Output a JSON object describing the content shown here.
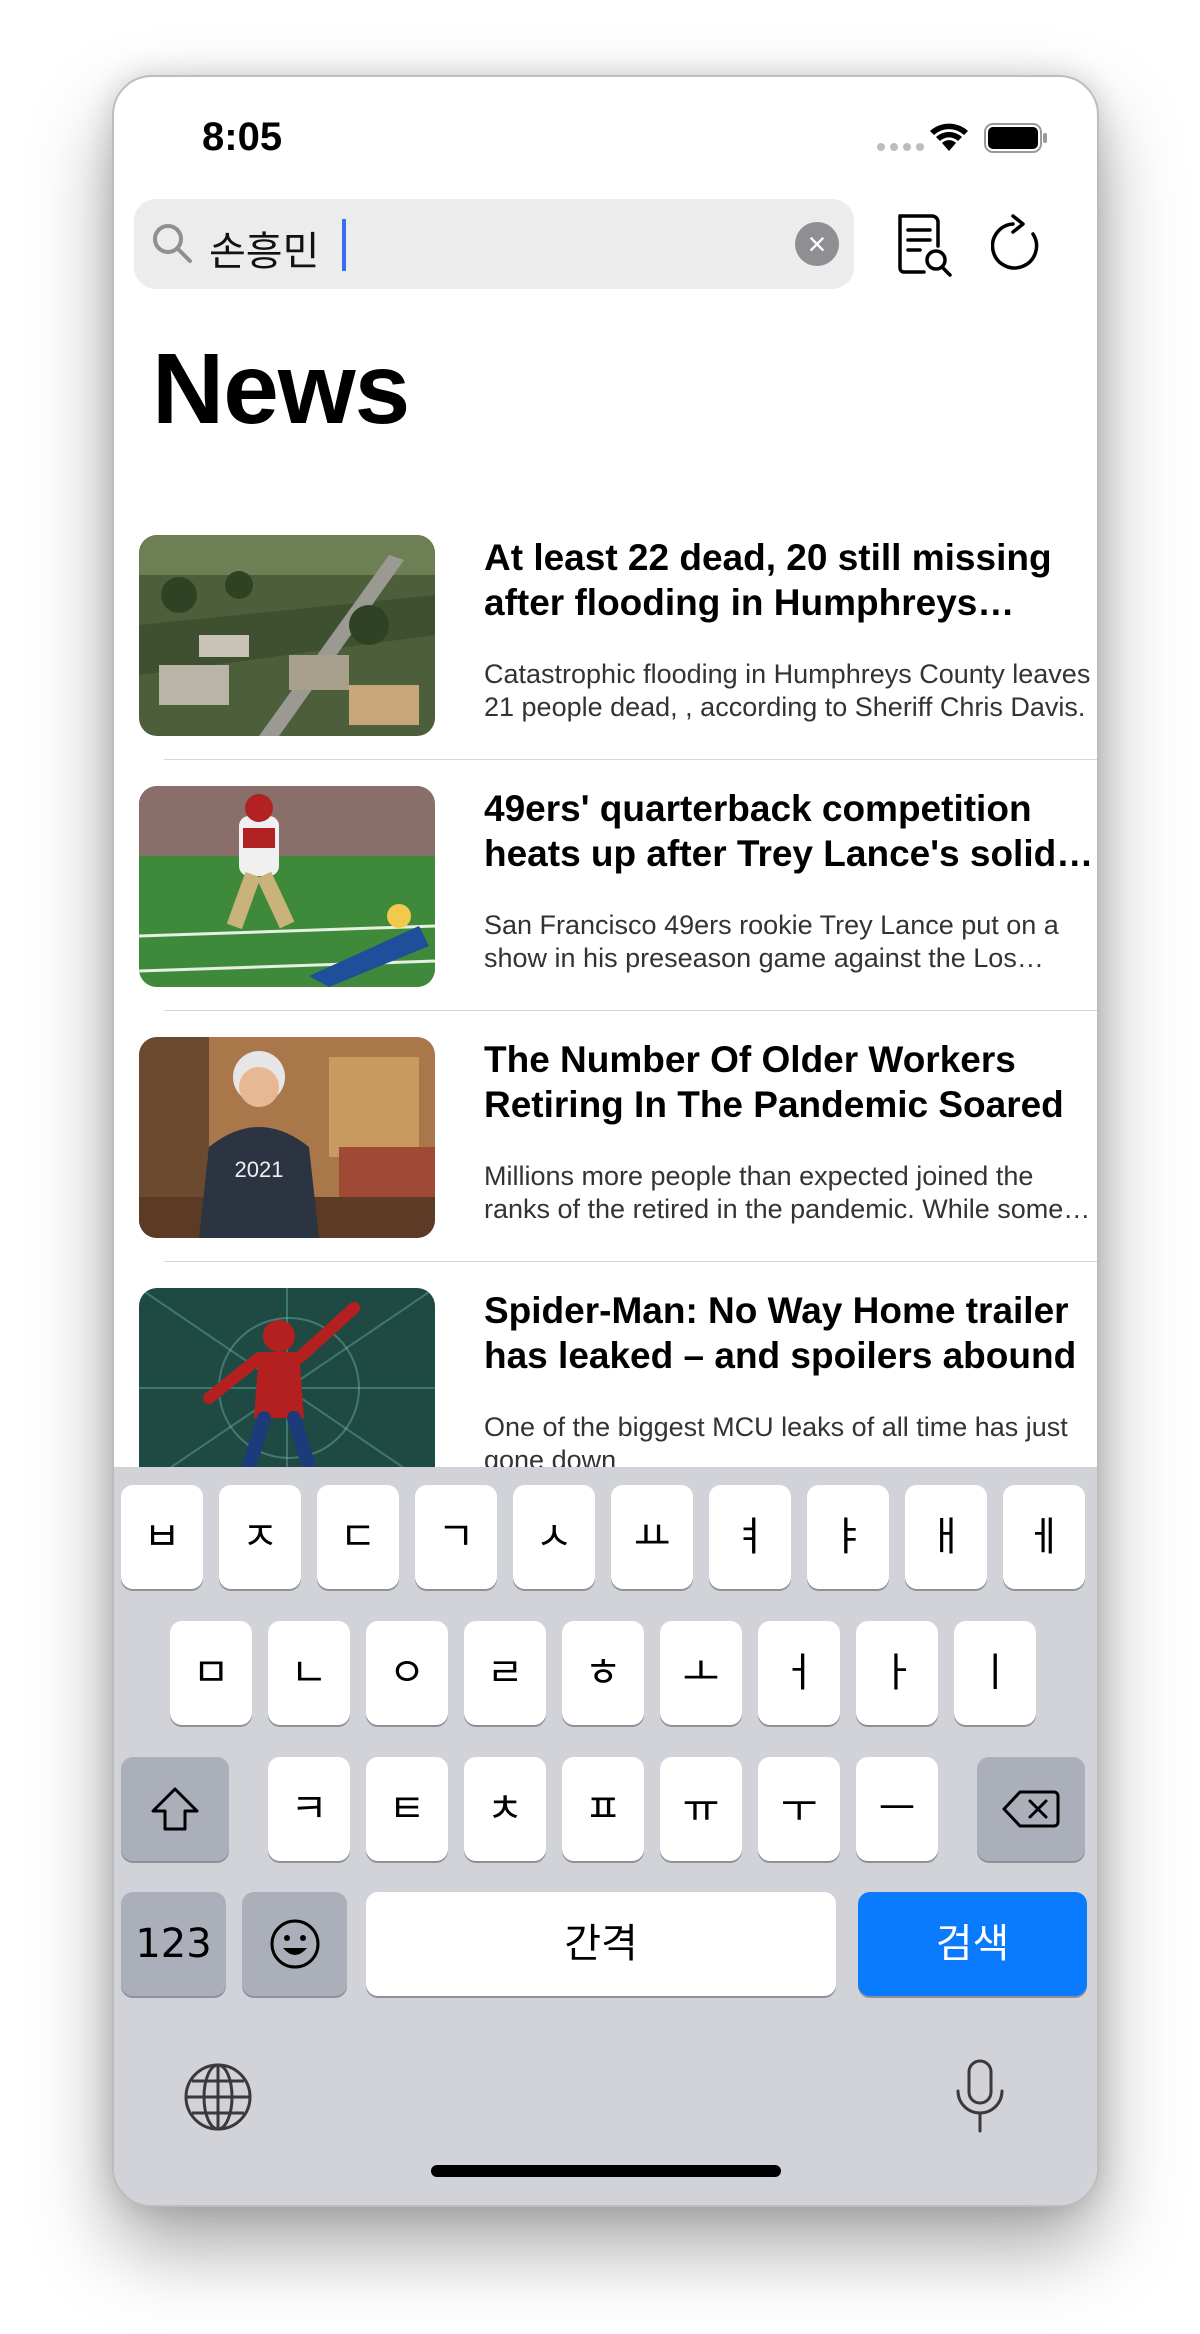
{
  "status_bar": {
    "time": "8:05"
  },
  "search": {
    "query": "손흥민"
  },
  "page": {
    "title": "News"
  },
  "articles": [
    {
      "title": "At least 22 dead, 20 still missing after flooding in Humphreys County",
      "summary": "Catastrophic flooding in Humphreys County leaves 21 people dead, , according to Sheriff Chris Davis."
    },
    {
      "title": "49ers' quarterback competition heats up after Trey Lance's solid outing",
      "summary": "San Francisco 49ers rookie Trey Lance put on a show in his preseason game against the Los Angeles Chargers."
    },
    {
      "title": "The Number Of Older Workers Retiring In The Pandemic Soared",
      "summary": "Millions more people than expected joined the ranks of the retired in the pandemic. While some were happy to leave."
    },
    {
      "title": "Spider-Man: No Way Home trailer has leaked – and spoilers abound",
      "summary": "One of the biggest MCU leaks of all time has just gone down"
    }
  ],
  "keyboard": {
    "row1": [
      "ㅂ",
      "ㅈ",
      "ㄷ",
      "ㄱ",
      "ㅅ",
      "ㅛ",
      "ㅕ",
      "ㅑ",
      "ㅐ",
      "ㅔ"
    ],
    "row2": [
      "ㅁ",
      "ㄴ",
      "ㅇ",
      "ㄹ",
      "ㅎ",
      "ㅗ",
      "ㅓ",
      "ㅏ",
      "ㅣ"
    ],
    "row3": [
      "ㅋ",
      "ㅌ",
      "ㅊ",
      "ㅍ",
      "ㅠ",
      "ㅜ",
      "ㅡ"
    ],
    "numbers_label": "123",
    "space_label": "간격",
    "search_label": "검색"
  },
  "colors": {
    "accent": "#0a7aff",
    "keyboard_bg": "#d1d3d9",
    "search_field_bg": "#ececec"
  }
}
